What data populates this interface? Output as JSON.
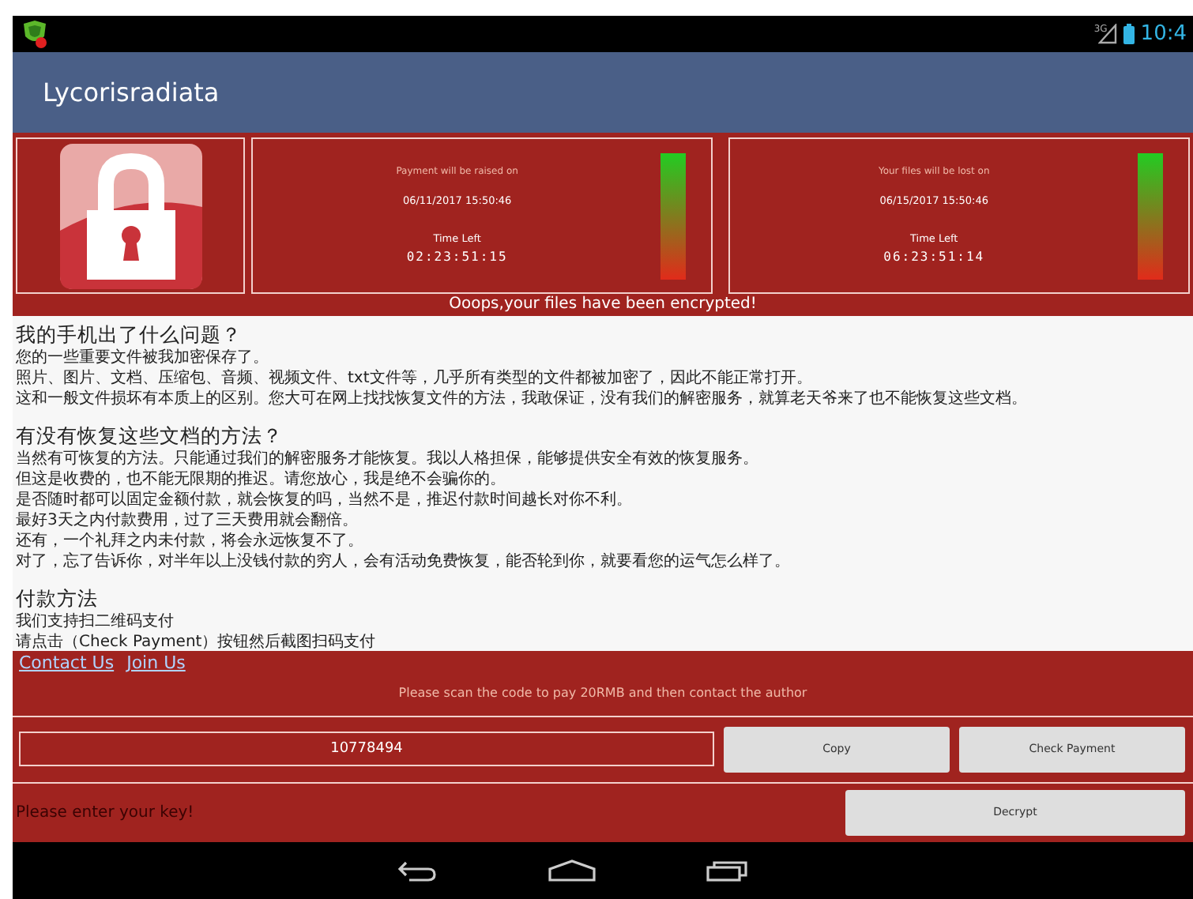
{
  "status_bar": {
    "time": "10:4",
    "network": "3G"
  },
  "app_bar": {
    "title": "Lycorisradiata"
  },
  "timers": [
    {
      "caption": "Payment will be raised on",
      "date": "06/11/2017 15:50:46",
      "label": "Time Left",
      "countdown": "02:23:51:15",
      "level": 1
    },
    {
      "caption": "Your files will be lost on",
      "date": "06/15/2017 15:50:46",
      "label": "Time Left",
      "countdown": "06:23:51:14",
      "level": 1
    }
  ],
  "banner": "Ooops,your files have been encrypted!",
  "sections": [
    {
      "heading": "我的手机出了什么问题？",
      "lines": [
        "您的一些重要文件被我加密保存了。",
        "照片、图片、文档、压缩包、音频、视频文件、txt文件等，几乎所有类型的文件都被加密了，因此不能正常打开。",
        "这和一般文件损坏有本质上的区别。您大可在网上找找恢复文件的方法，我敢保证，没有我们的解密服务，就算老天爷来了也不能恢复这些文档。"
      ]
    },
    {
      "heading": "有没有恢复这些文档的方法？",
      "lines": [
        "当然有可恢复的方法。只能通过我们的解密服务才能恢复。我以人格担保，能够提供安全有效的恢复服务。",
        "但这是收费的，也不能无限期的推迟。请您放心，我是绝不会骗你的。",
        "是否随时都可以固定金额付款，就会恢复的吗，当然不是，推迟付款时间越长对你不利。",
        "最好3天之内付款费用，过了三天费用就会翻倍。",
        "还有，一个礼拜之内未付款，将会永远恢复不了。",
        "对了，忘了告诉你，对半年以上没钱付款的穷人，会有活动免费恢复，能否轮到你，就要看您的运气怎么样了。"
      ]
    },
    {
      "heading": "付款方法",
      "lines": [
        "我们支持扫二维码支付",
        "请点击（Check Payment）按钮然后截图扫码支付"
      ]
    }
  ],
  "links": [
    "Contact Us",
    "Join Us"
  ],
  "notice": "Please scan the code to pay 20RMB and then contact the author",
  "code_field": {
    "value": "10778494"
  },
  "buttons": [
    "Copy",
    "Check Payment"
  ],
  "key_field": {
    "placeholder": "Please enter your key!"
  },
  "decrypt_button": "Decrypt"
}
